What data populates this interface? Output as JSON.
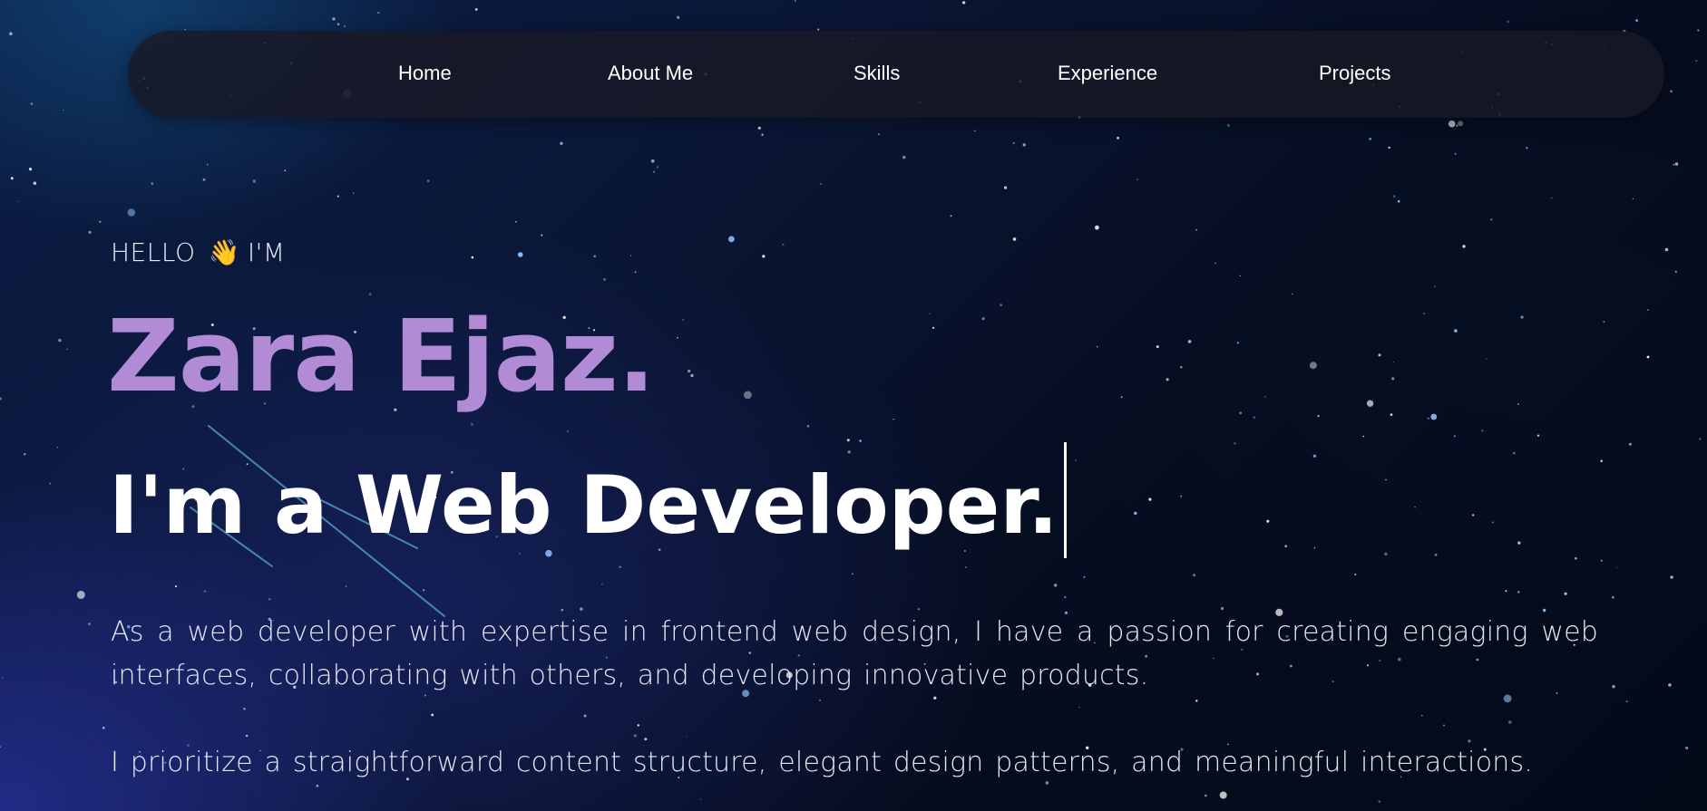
{
  "nav": {
    "items": [
      {
        "label": "Home"
      },
      {
        "label": "About Me"
      },
      {
        "label": "Skills"
      },
      {
        "label": "Experience"
      },
      {
        "label": "Projects"
      }
    ]
  },
  "hero": {
    "greeting_prefix": "HELLO",
    "greeting_emoji": "👋",
    "greeting_suffix": "I'M",
    "name": "Zara Ejaz.",
    "typed_role": "I'm a Web Developer.",
    "paragraph_1": "As a web developer with expertise in frontend web design, I have a passion for creating engaging web interfaces, collaborating with others, and developing innovative products.",
    "paragraph_2": "I prioritize a straightforward content structure, elegant design patterns, and meaningful interactions."
  },
  "colors": {
    "accent_name": "#b28bd6",
    "navbar_bg": "#18182a",
    "text_primary": "#ffffff",
    "background_deep": "#060d20"
  }
}
